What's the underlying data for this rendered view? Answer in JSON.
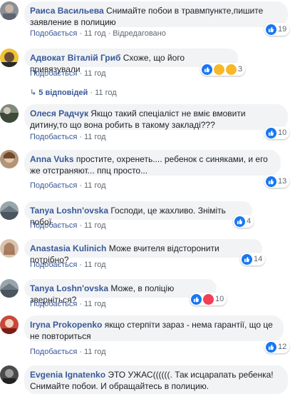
{
  "labels": {
    "like": "Подобається",
    "time": "11 год",
    "edited": "Відредаговано",
    "replies": "5 відповідей"
  },
  "comments": [
    {
      "author": "Раиса Васильева",
      "text": "Снимайте побои в травмпункте,пишите заявление в полицию",
      "reactions": "19",
      "edited": true
    },
    {
      "author": "Адвокат Віталій Гриб",
      "text": "Схоже, що його привязували",
      "reactions": "3"
    },
    {
      "author": "Олеся Радчук",
      "text": "Якщо такий спеціаліст не вміє вмовити дитину,то що вона робить в такому закладі???",
      "reactions": "10"
    },
    {
      "author": "Anna Vuks",
      "text": "простите, охренеть.... ребенок с синяками, и его же отстраняют... ппц просто...",
      "reactions": "13"
    },
    {
      "author": "Tanya Loshn'ovska",
      "text": "Господи, це жахливо. Зніміть побої.",
      "reactions": "4"
    },
    {
      "author": "Anastasia Kulinich",
      "text": "Може вчителя відсторонити потрібно?",
      "reactions": "14"
    },
    {
      "author": "Tanya Loshn'ovska",
      "text": "Може, в поліцію зверніться?",
      "reactions": "10"
    },
    {
      "author": "Iryna Prokopenko",
      "text": "якщо стерпіти зараз - нема гарантії, що це не повториться",
      "reactions": "12"
    },
    {
      "author": "Evgenia Ignatenko",
      "text": "ЭТО УЖАС((((((. Так исцарапать ребенка! Снимайте побои. И обращайтесь в полицию.",
      "reactions": ""
    }
  ],
  "colors": {
    "link": "#385898",
    "bubble": "#f2f3f5",
    "like": "#1877f2",
    "love": "#f33e58"
  }
}
